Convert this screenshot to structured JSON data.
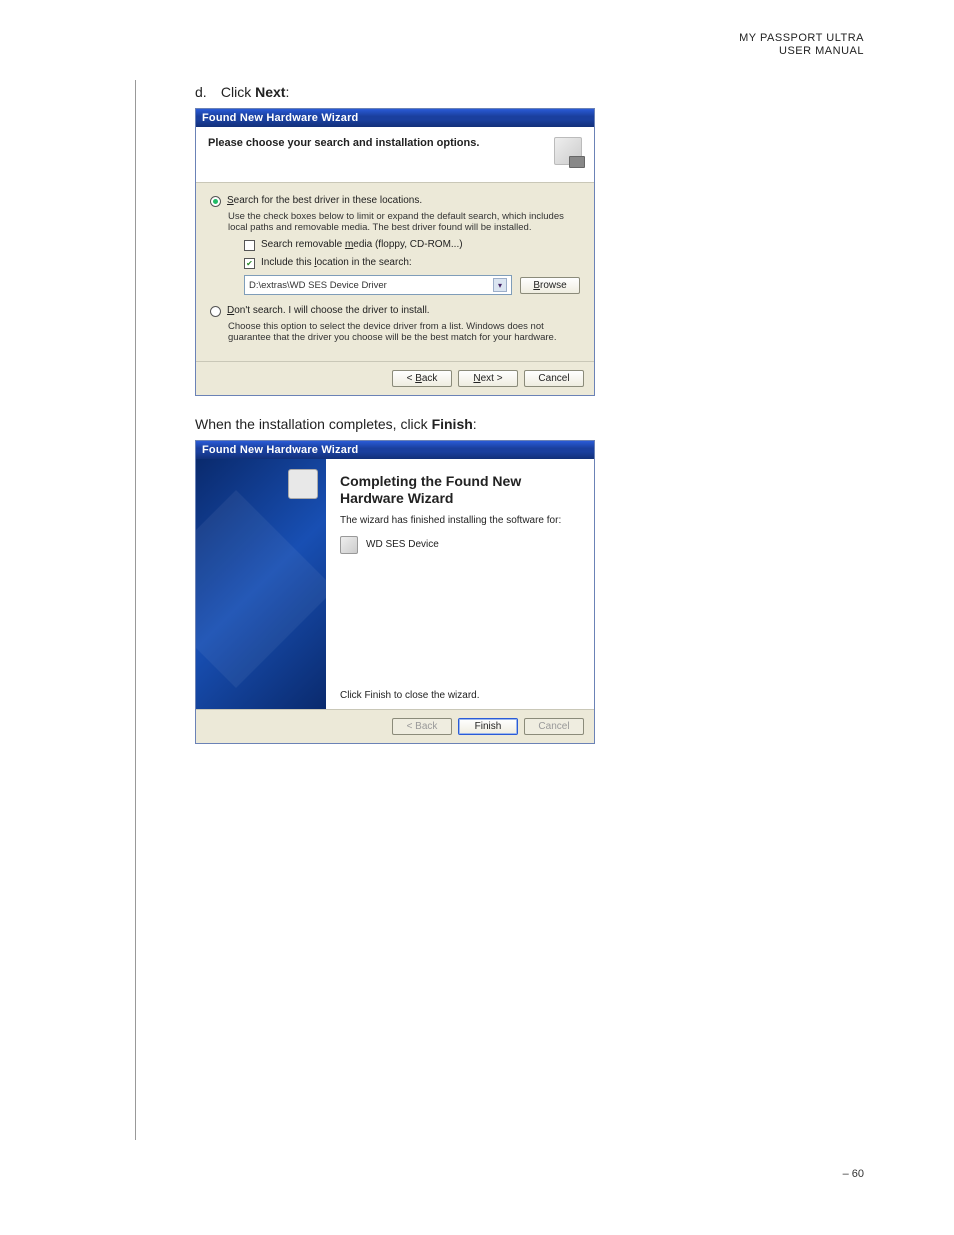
{
  "header": {
    "line1": "MY PASSPORT ULTRA",
    "line2": "USER MANUAL"
  },
  "step_d": {
    "marker": "d.",
    "prefix": "Click ",
    "bold": "Next",
    "suffix": ":"
  },
  "dialog1": {
    "title": "Found New Hardware Wizard",
    "header_title": "Please choose your search and installation options.",
    "radio_search_prefix": "S",
    "radio_search_rest": "earch for the best driver in these locations.",
    "search_desc": "Use the check boxes below to limit or expand the default search, which includes local paths and removable media. The best driver found will be installed.",
    "chk_removable_prefix": "Search removable ",
    "chk_removable_u": "m",
    "chk_removable_rest": "edia (floppy, CD-ROM...)",
    "chk_include_prefix": "Include this ",
    "chk_include_u": "l",
    "chk_include_rest": "ocation in the search:",
    "path_value": "D:\\extras\\WD SES Device Driver",
    "browse_u": "B",
    "browse_rest": "rowse",
    "radio_dont_u": "D",
    "radio_dont_rest": "on't search. I will choose the driver to install.",
    "dont_desc": "Choose this option to select the device driver from a list. Windows does not guarantee that the driver you choose will be the best match for your hardware.",
    "btn_back_prefix": "< ",
    "btn_back_u": "B",
    "btn_back_rest": "ack",
    "btn_next_u": "N",
    "btn_next_rest": "ext >",
    "btn_cancel": "Cancel"
  },
  "step_e": {
    "prefix": "When the installation completes, click ",
    "bold": "Finish",
    "suffix": ":"
  },
  "dialog2": {
    "title": "Found New Hardware Wizard",
    "main_title": "Completing the Found New Hardware Wizard",
    "sub": "The wizard has finished installing the software for:",
    "device": "WD SES Device",
    "note": "Click Finish to close the wizard.",
    "btn_back": "< Back",
    "btn_finish": "Finish",
    "btn_cancel": "Cancel"
  },
  "footer": {
    "page": "– 60"
  }
}
